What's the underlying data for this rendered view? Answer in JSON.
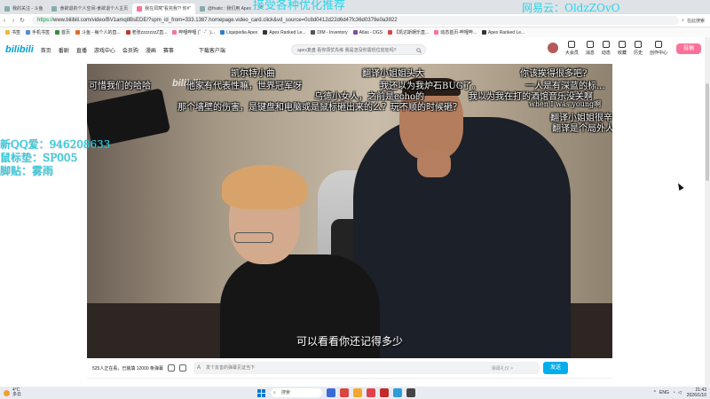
{
  "browser": {
    "tabs": [
      {
        "label": "我的关注 - 斗鱼",
        "active": false
      },
      {
        "label": "食欲退的个人空间-食欲退个人主页",
        "active": false
      },
      {
        "label": "我在洞窝\"看完我?! 你#\"",
        "active": true
      },
      {
        "label": "@fnatic : 我们用 Apex",
        "active": false
      }
    ],
    "new_tab": "+",
    "url_scheme": "https://",
    "url_rest": "www.bilibili.com/video/BV1amq8BsEDE/?spm_id_from=333.1387.homepage.video_card.click&vd_source=0c8d0412d22d6d47fc36d0379e0a3922",
    "right_label": "在此搜索",
    "bookmarks": [
      "书签",
      "手机书签",
      "首页",
      "斗鱼 - 每个人的直...",
      "老张zzzzzzzZ直...",
      "哔哩哔哩 (゜-゜)...",
      "Liquipedia Apex",
      "Apex Ranked Le...",
      "DIM - Inventory",
      "Atlas - DGS",
      "【凯达斯娱乐直...",
      "动态首页-哔哩哔...",
      "Apex Ranked Le..."
    ]
  },
  "site": {
    "logo": "bilibili",
    "nav": [
      "首页",
      "番剧",
      "直播",
      "游戏中心",
      "会员购",
      "漫画",
      "赛事"
    ],
    "download_label": "下载客户端",
    "search_placeholder": "apex复盘 看你领优先练 我是怎没你需低位尬尬吗?",
    "header_items": [
      "大会员",
      "消息",
      "动态",
      "收藏",
      "历史",
      "创作中心"
    ],
    "upload_label": "投稿"
  },
  "overlays": {
    "left_lines": [
      "新QQ爱：946208633",
      "鼠标垫：SP005",
      "脚贴：雾雨"
    ],
    "top_center": "接受各种优化推荐",
    "top_right": "网易云：OldzZOvO"
  },
  "video": {
    "watermark": "bilibili",
    "danmaku": [
      "凯尔特小曲",
      "翻译小姐姐头大",
      "你该挨得很多吧?",
      "他家有代表性嘛，世界冠军呀",
      "我还以为我炉石BUG了。",
      "一人是有深蓝的标...",
      "乌德小女人，之前是echo的",
      "我以为我在打的酒馆音乐没关啊",
      "那个墙壁的伤害，是键盘和电脑或是鼠标砸出来的么？玩不顺的时候砸？",
      "when I was young啊",
      "翻译小姐姐很辛苦",
      "翻译是个局外人",
      "可惜我们的哈哈"
    ],
    "subtitle": "可以看看你还记得多少"
  },
  "controls": {
    "viewers_text": "525人正在看，已装填 12000 条弹幕",
    "danmaku_placeholder": "发个友善的弹幕见证当下",
    "etiquette_label": "弹幕礼仪 >",
    "send_label": "发送"
  },
  "taskbar": {
    "weather_temp": "4°C",
    "weather_desc": "多云",
    "search_label": "搜索",
    "lang": "ENG",
    "time": "21:43",
    "date": "2026/1/10"
  }
}
